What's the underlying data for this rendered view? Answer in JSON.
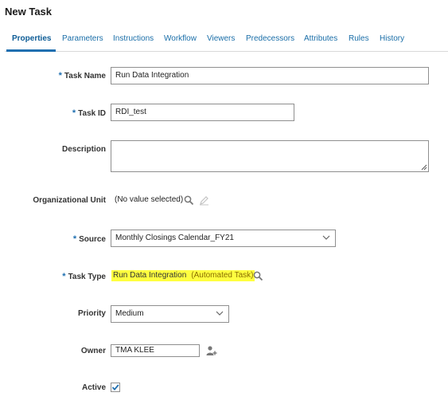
{
  "page": {
    "title": "New Task"
  },
  "tabs": [
    {
      "label": "Properties",
      "active": true
    },
    {
      "label": "Parameters"
    },
    {
      "label": "Instructions"
    },
    {
      "label": "Workflow"
    },
    {
      "label": "Viewers"
    },
    {
      "label": "Predecessors"
    },
    {
      "label": "Attributes"
    },
    {
      "label": "Rules"
    },
    {
      "label": "History"
    }
  ],
  "form": {
    "task_name": {
      "label": "Task Name",
      "required": "*",
      "value": "Run Data Integration"
    },
    "task_id": {
      "label": "Task ID",
      "required": "*",
      "value": "RDI_test"
    },
    "description": {
      "label": "Description",
      "value": ""
    },
    "org_unit": {
      "label": "Organizational Unit",
      "value": "(No value selected)"
    },
    "source": {
      "label": "Source",
      "required": "*",
      "value": "Monthly Closings Calendar_FY21"
    },
    "task_type": {
      "label": "Task Type",
      "required": "*",
      "value": "Run Data Integration",
      "qualifier": "(Automated Task)",
      "highlight_color": "#ffff40"
    },
    "priority": {
      "label": "Priority",
      "value": "Medium"
    },
    "owner": {
      "label": "Owner",
      "value": "TMA KLEE"
    },
    "active": {
      "label": "Active",
      "checked": true
    }
  },
  "colors": {
    "accent": "#1f6fb0",
    "link": "#1a6ea8"
  },
  "icons": [
    "search-icon",
    "edit-icon",
    "chevron-down-icon",
    "add-user-icon",
    "checkmark-icon",
    "resize-handle-icon"
  ]
}
